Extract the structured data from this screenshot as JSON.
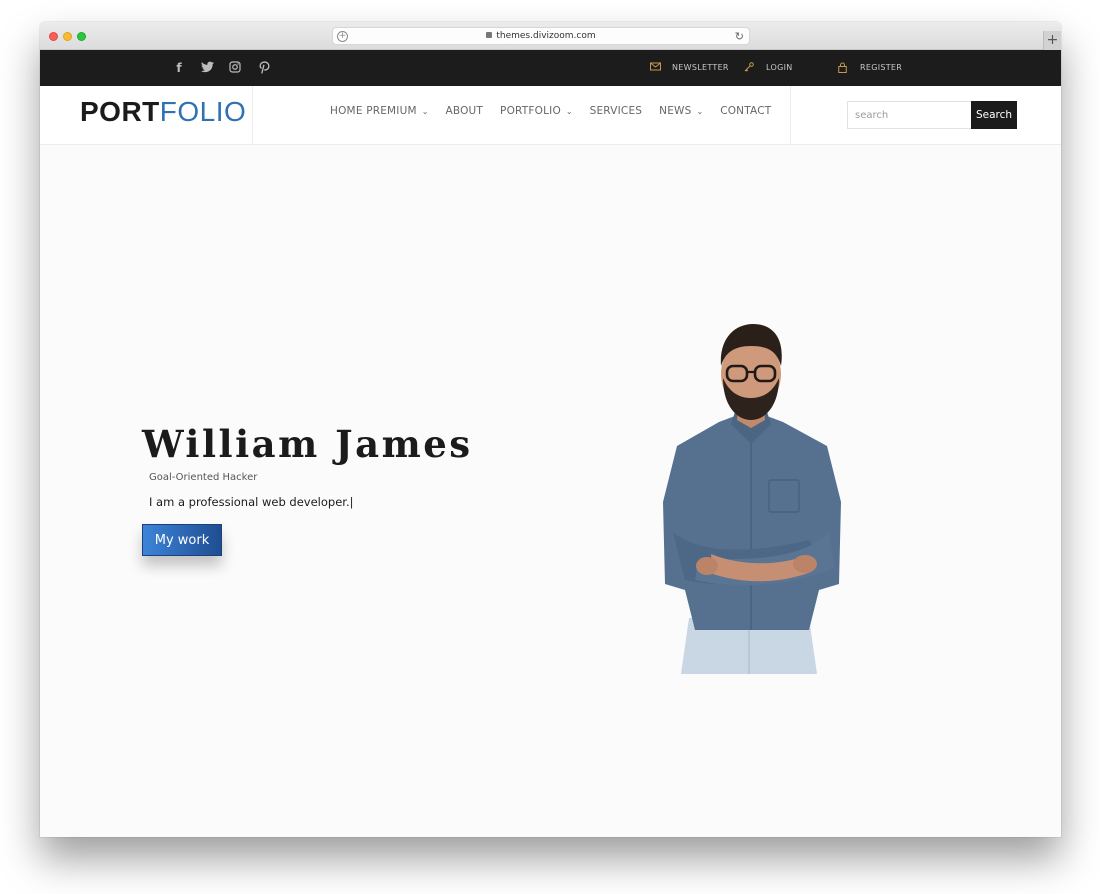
{
  "browser": {
    "url": "themes.divizoom.com",
    "new_tab_label": "+"
  },
  "topbar": {
    "social_icons": [
      "facebook-icon",
      "twitter-icon",
      "instagram-icon",
      "pinterest-icon"
    ],
    "links": [
      {
        "label": "NEWSLETTER",
        "icon": "envelope-icon"
      },
      {
        "label": "LOGIN",
        "icon": "key-icon"
      },
      {
        "label": "REGISTER",
        "icon": "lock-icon"
      }
    ],
    "icon_color": "#c9964d"
  },
  "header": {
    "logo_bold": "PORT",
    "logo_light": "FOLIO",
    "logo_light_color": "#2f72b4",
    "nav": [
      {
        "label": "HOME PREMIUM",
        "has_dropdown": true
      },
      {
        "label": "ABOUT",
        "has_dropdown": false
      },
      {
        "label": "PORTFOLIO",
        "has_dropdown": true
      },
      {
        "label": "SERVICES",
        "has_dropdown": false
      },
      {
        "label": "NEWS",
        "has_dropdown": true
      },
      {
        "label": "CONTACT",
        "has_dropdown": false
      }
    ],
    "search": {
      "placeholder": "search",
      "button_label": "Search"
    }
  },
  "hero": {
    "name": "William James",
    "subtitle": "Goal-Oriented Hacker",
    "description": "I am a professional web developer.|",
    "button_label": "My work",
    "button_color": "#2e6bbd"
  }
}
